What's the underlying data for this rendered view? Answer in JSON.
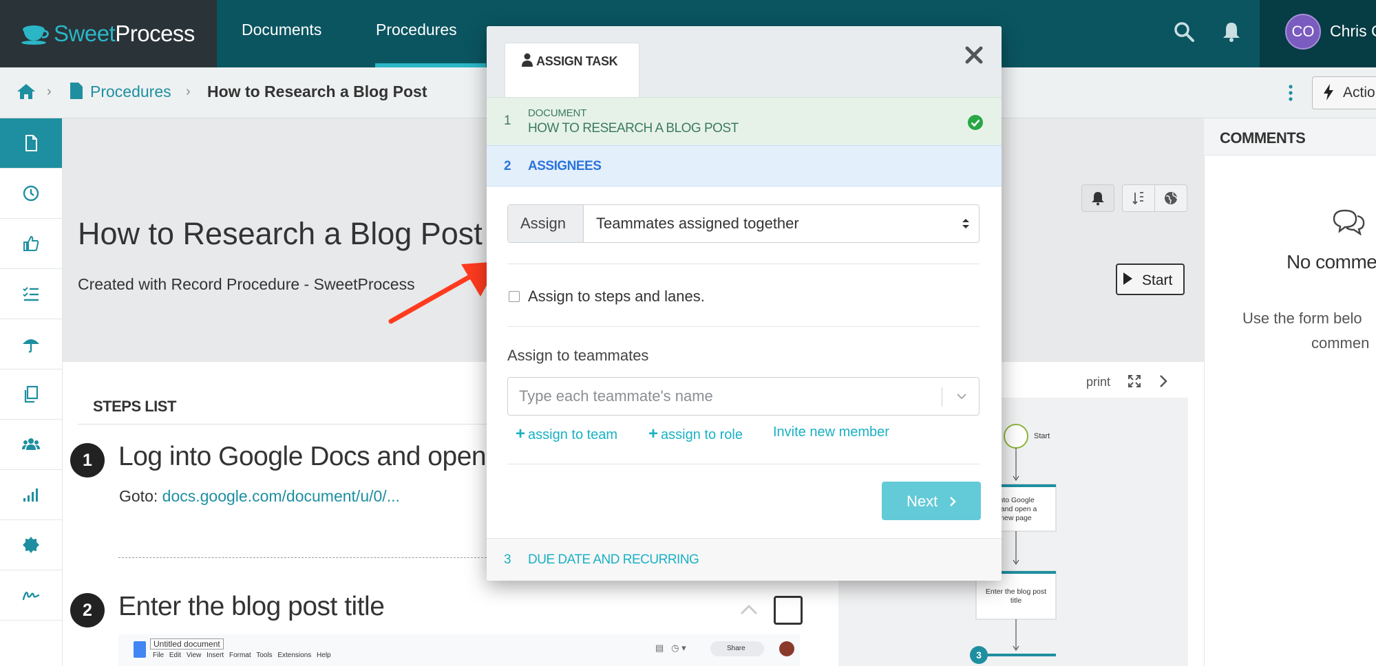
{
  "brand": {
    "part1": "Sweet",
    "part2": "Process"
  },
  "nav": {
    "items": [
      "Documents",
      "Procedures"
    ],
    "active": "Procedures"
  },
  "user": {
    "initials": "CO",
    "name": "Chris C"
  },
  "breadcrumb": {
    "link": "Procedures",
    "current": "How to Research a Blog Post"
  },
  "actions_label": "Actio",
  "document": {
    "title": "How to Research a Blog Post",
    "subtitle": "Created with Record Procedure - SweetProcess",
    "start_label": "Start"
  },
  "steps": {
    "heading": "STEPS LIST",
    "items": [
      {
        "number": "1",
        "title": "Log into Google Docs and open",
        "goto_prefix": "Goto:",
        "goto_link": "docs.google.com/document/u/0/..."
      },
      {
        "number": "2",
        "title": "Enter the blog post title"
      }
    ]
  },
  "gdoc": {
    "doc_name": "Untitled document",
    "menu": "File Edit View Insert Format Tools Extensions Help",
    "share": "Share"
  },
  "flowchart": {
    "print_label": "print",
    "start_label": "Start",
    "node1": "into Google\ns and open a\nnew page",
    "node2": "Enter the blog post\ntitle",
    "node3_num": "3"
  },
  "comments": {
    "title": "COMMENTS",
    "empty": "No comme",
    "hint_line1": "Use the form belo",
    "hint_line2": "commen"
  },
  "modal": {
    "tab_label": "ASSIGN TASK",
    "step1": {
      "num": "1",
      "caption": "DOCUMENT",
      "title": "HOW TO RESEARCH A BLOG POST"
    },
    "step2": {
      "num": "2",
      "label": "ASSIGNEES"
    },
    "assign": {
      "addon": "Assign",
      "value": "Teammates assigned together"
    },
    "checkbox_label": "Assign to steps and lanes.",
    "teammates_label": "Assign to teammates",
    "teammates_placeholder": "Type each teammate's name",
    "links": {
      "team": "assign to team",
      "role": "assign to role",
      "invite": "Invite new member"
    },
    "next_label": "Next",
    "step3": {
      "num": "3",
      "label": "DUE DATE AND RECURRING"
    }
  },
  "colors": {
    "nav_bg": "#0a5560",
    "brand_bg": "#2a3338",
    "accent": "#1e8fa0",
    "link": "#1ab0c4",
    "annotation_arrow": "#ff3b1f",
    "next_button": "#63cad8",
    "completed_green": "#28a745"
  }
}
